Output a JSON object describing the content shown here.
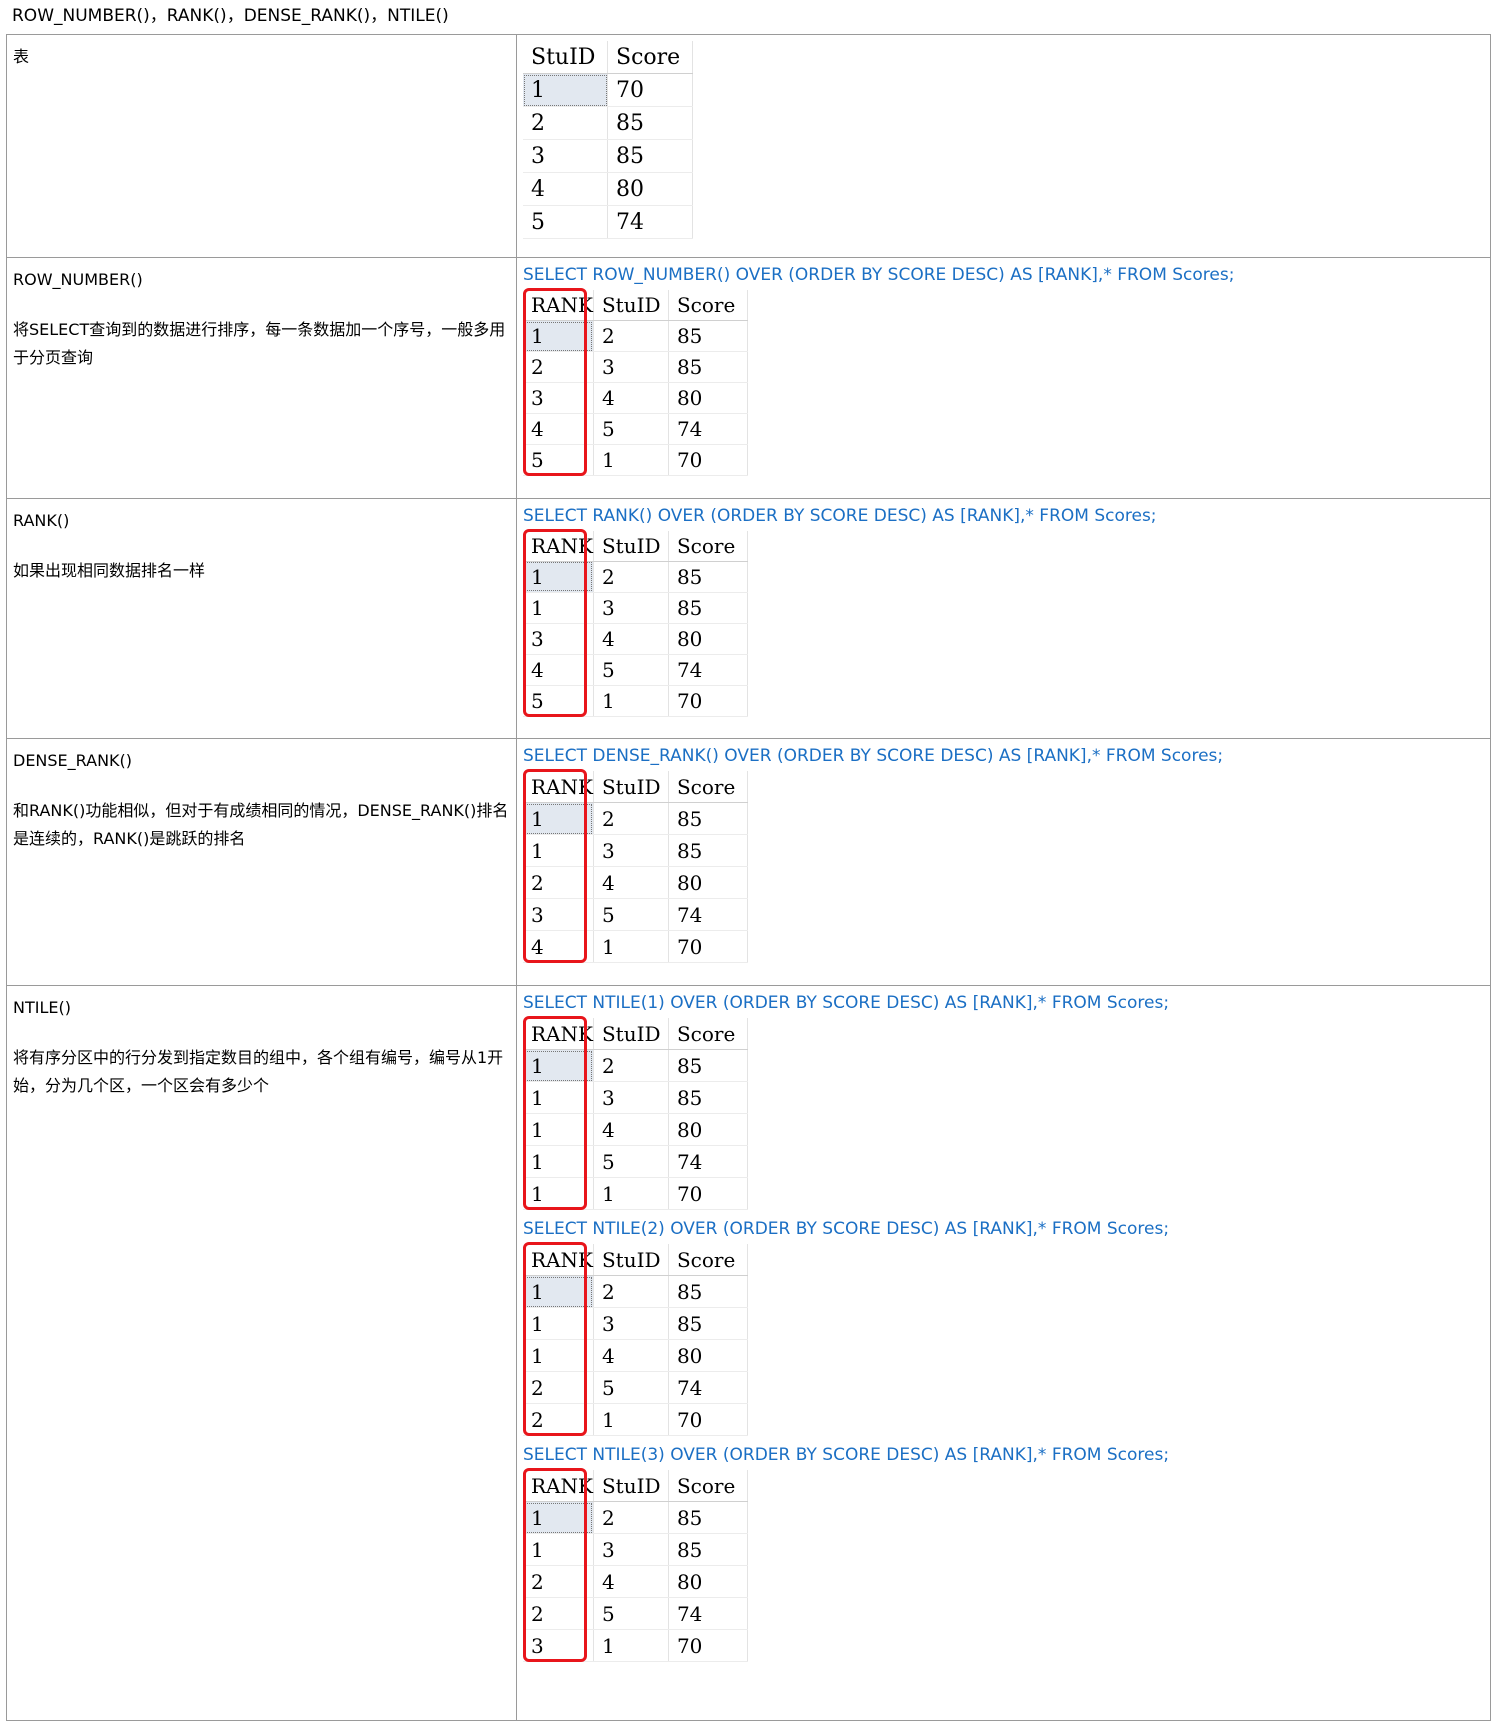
{
  "title": "ROW_NUMBER()，RANK()，DENSE_RANK()，NTILE()",
  "base": {
    "label": "表",
    "headers": [
      "StuID",
      "Score"
    ],
    "rows": [
      [
        "1",
        "70"
      ],
      [
        "2",
        "85"
      ],
      [
        "3",
        "85"
      ],
      [
        "4",
        "80"
      ],
      [
        "5",
        "74"
      ]
    ]
  },
  "sections": [
    {
      "fn": "ROW_NUMBER()",
      "desc": "将SELECT查询到的数据进行排序，每一条数据加一个序号，一般多用于分页查询",
      "queries": [
        {
          "sql": "SELECT ROW_NUMBER() OVER (ORDER BY SCORE DESC) AS [RANK],* FROM Scores;",
          "headers": [
            "RANK",
            "StuID",
            "Score"
          ],
          "rows": [
            [
              "1",
              "2",
              "85"
            ],
            [
              "2",
              "3",
              "85"
            ],
            [
              "3",
              "4",
              "80"
            ],
            [
              "4",
              "5",
              "74"
            ],
            [
              "5",
              "1",
              "70"
            ]
          ]
        }
      ]
    },
    {
      "fn": "RANK()",
      "desc": "如果出现相同数据排名一样",
      "queries": [
        {
          "sql": "SELECT RANK() OVER (ORDER BY SCORE DESC) AS [RANK],* FROM Scores;",
          "headers": [
            "RANK",
            "StuID",
            "Score"
          ],
          "rows": [
            [
              "1",
              "2",
              "85"
            ],
            [
              "1",
              "3",
              "85"
            ],
            [
              "3",
              "4",
              "80"
            ],
            [
              "4",
              "5",
              "74"
            ],
            [
              "5",
              "1",
              "70"
            ]
          ]
        }
      ]
    },
    {
      "fn": "DENSE_RANK()",
      "desc": "和RANK()功能相似，但对于有成绩相同的情况，DENSE_RANK()排名是连续的，RANK()是跳跃的排名",
      "queries": [
        {
          "sql": "SELECT DENSE_RANK() OVER (ORDER BY SCORE DESC) AS [RANK],* FROM Scores;",
          "headers": [
            "RANK",
            "StuID",
            "Score"
          ],
          "rows": [
            [
              "1",
              "2",
              "85"
            ],
            [
              "1",
              "3",
              "85"
            ],
            [
              "2",
              "4",
              "80"
            ],
            [
              "3",
              "5",
              "74"
            ],
            [
              "4",
              "1",
              "70"
            ]
          ]
        }
      ]
    },
    {
      "fn": "NTILE()",
      "desc": "将有序分区中的行分发到指定数目的组中，各个组有编号，编号从1开始，分为几个区，一个区会有多少个",
      "queries": [
        {
          "sql": "SELECT NTILE(1) OVER (ORDER BY SCORE DESC) AS [RANK],* FROM Scores;",
          "headers": [
            "RANK",
            "StuID",
            "Score"
          ],
          "rows": [
            [
              "1",
              "2",
              "85"
            ],
            [
              "1",
              "3",
              "85"
            ],
            [
              "1",
              "4",
              "80"
            ],
            [
              "1",
              "5",
              "74"
            ],
            [
              "1",
              "1",
              "70"
            ]
          ]
        },
        {
          "sql": "SELECT NTILE(2) OVER (ORDER BY SCORE DESC) AS [RANK],* FROM Scores;",
          "headers": [
            "RANK",
            "StuID",
            "Score"
          ],
          "rows": [
            [
              "1",
              "2",
              "85"
            ],
            [
              "1",
              "3",
              "85"
            ],
            [
              "1",
              "4",
              "80"
            ],
            [
              "2",
              "5",
              "74"
            ],
            [
              "2",
              "1",
              "70"
            ]
          ]
        },
        {
          "sql": "SELECT NTILE(3) OVER (ORDER BY SCORE DESC) AS [RANK],* FROM Scores;",
          "headers": [
            "RANK",
            "StuID",
            "Score"
          ],
          "rows": [
            [
              "1",
              "2",
              "85"
            ],
            [
              "1",
              "3",
              "85"
            ],
            [
              "2",
              "4",
              "80"
            ],
            [
              "2",
              "5",
              "74"
            ],
            [
              "3",
              "1",
              "70"
            ]
          ]
        }
      ]
    }
  ]
}
